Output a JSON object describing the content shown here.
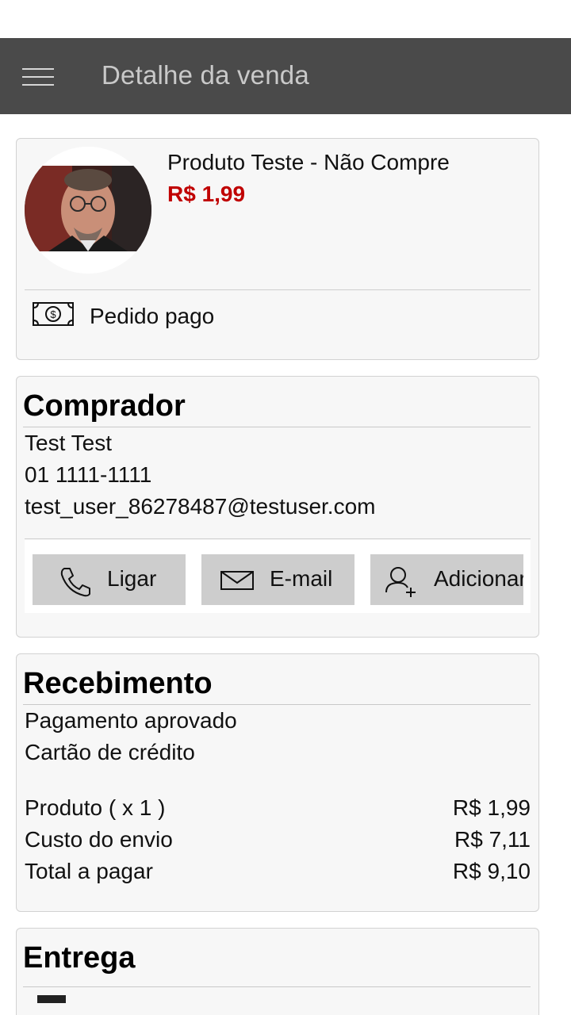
{
  "app_bar": {
    "menu_icon": "hamburger-menu-icon",
    "title": "Detalhe da venda"
  },
  "product": {
    "name": "Produto Teste - Não Compre",
    "price": "R$ 1,99",
    "price_color": "#c00000",
    "status_icon": "money-bill-icon",
    "status": "Pedido pago"
  },
  "buyer": {
    "section_title": "Comprador",
    "name": "Test Test",
    "phone": "01 1111-1111",
    "email": "test_user_86278487@testuser.com",
    "actions": [
      {
        "label": "Ligar",
        "icon": "phone-icon"
      },
      {
        "label": "E-mail",
        "icon": "mail-icon"
      },
      {
        "label": "Adicionar",
        "icon": "add-contact-icon"
      }
    ]
  },
  "payment": {
    "section_title": "Recebimento",
    "status": "Pagamento aprovado",
    "method": "Cartão de crédito",
    "lines": [
      {
        "label": "Produto  ( x 1  )",
        "value": "R$ 1,99"
      },
      {
        "label": "Custo do envio",
        "value": "R$ 7,11"
      },
      {
        "label": "Total a pagar",
        "value": "R$ 9,10"
      }
    ]
  },
  "delivery": {
    "section_title": "Entrega"
  },
  "colors": {
    "app_bar": "#4a4a4a",
    "card_background": "#f7f7f7",
    "button_background": "#cdcdcd"
  }
}
